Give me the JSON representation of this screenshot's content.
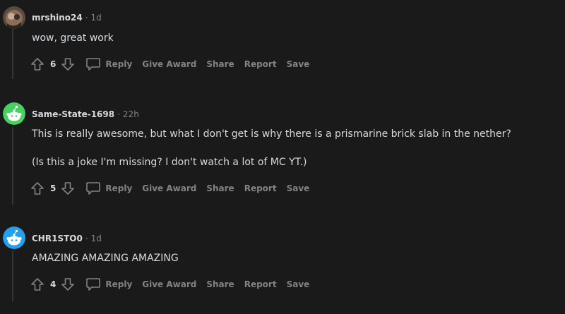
{
  "comments": [
    {
      "author": "mrshino24",
      "time": "1d",
      "body": [
        "wow, great work"
      ],
      "score": "6",
      "actions": {
        "reply": "Reply",
        "give_award": "Give Award",
        "share": "Share",
        "report": "Report",
        "save": "Save"
      }
    },
    {
      "author": "Same-State-1698",
      "time": "22h",
      "body": [
        "This is really awesome, but what I don't get is why there is a prismarine brick slab in the nether?",
        "(Is this a joke I'm missing? I don't watch a lot of MC YT.)"
      ],
      "score": "5",
      "actions": {
        "reply": "Reply",
        "give_award": "Give Award",
        "share": "Share",
        "report": "Report",
        "save": "Save"
      }
    },
    {
      "author": "CHR1STO0",
      "time": "1d",
      "body": [
        "AMAZING AMAZING AMAZING"
      ],
      "score": "4",
      "actions": {
        "reply": "Reply",
        "give_award": "Give Award",
        "share": "Share",
        "report": "Report",
        "save": "Save"
      }
    }
  ],
  "icons": {
    "upvote": "arrow-up-icon",
    "downvote": "arrow-down-icon",
    "reply": "speech-bubble-icon"
  },
  "colors": {
    "background": "#1a1a1b",
    "text": "#d7dadc",
    "muted": "#818384",
    "avatar_green": "#46d160",
    "avatar_blue": "#24a0ed"
  }
}
